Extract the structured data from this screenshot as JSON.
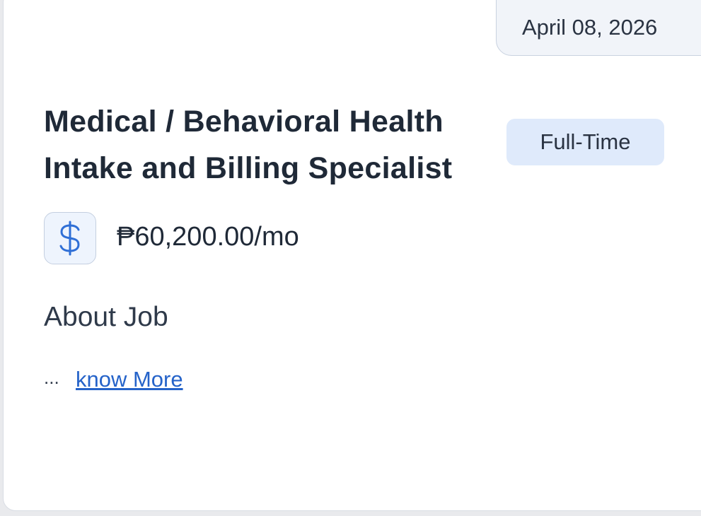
{
  "job": {
    "posted_date": "April 08, 2026",
    "title": "Medical / Behavioral Health Intake and Billing Specialist",
    "employment_type": "Full-Time",
    "salary": "₱60,200.00/mo",
    "salary_icon": "dollar-icon",
    "about_heading": "About Job",
    "ellipsis": "...",
    "know_more_label": "know More"
  },
  "colors": {
    "accent": "#2563c9",
    "badge_bg": "#dfeafb",
    "date_badge_bg": "#f1f4f9",
    "text": "#1f2937"
  }
}
